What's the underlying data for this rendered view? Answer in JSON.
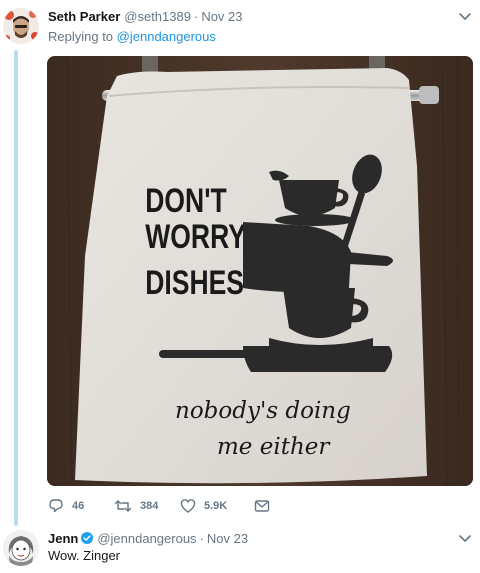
{
  "tweets": [
    {
      "author_name": "Seth Parker",
      "handle": "@seth1389",
      "separator": "·",
      "time": "Nov 23",
      "replying_label": "Replying to",
      "replying_to": "@jenndangerous",
      "image": {
        "line1": "DON'T",
        "line2": "WORRY",
        "line3": "DISHES",
        "script1": "nobody's doing",
        "script2": "me either"
      },
      "actions": {
        "replies": "46",
        "retweets": "384",
        "likes": "5.9K"
      }
    },
    {
      "author_name": "Jenn",
      "handle": "@jenndangerous",
      "separator": "·",
      "time": "Nov 23",
      "text": "Wow. Zinger"
    }
  ],
  "icons": {
    "reply": "reply-icon",
    "retweet": "retweet-icon",
    "like": "heart-icon",
    "dm": "envelope-icon",
    "verified": "verified-badge-icon",
    "menu": "chevron-down-icon"
  },
  "colors": {
    "link": "#1b95e0",
    "muted": "#657786",
    "thread_line": "#b7dbf2",
    "verified": "#1da1f2"
  }
}
